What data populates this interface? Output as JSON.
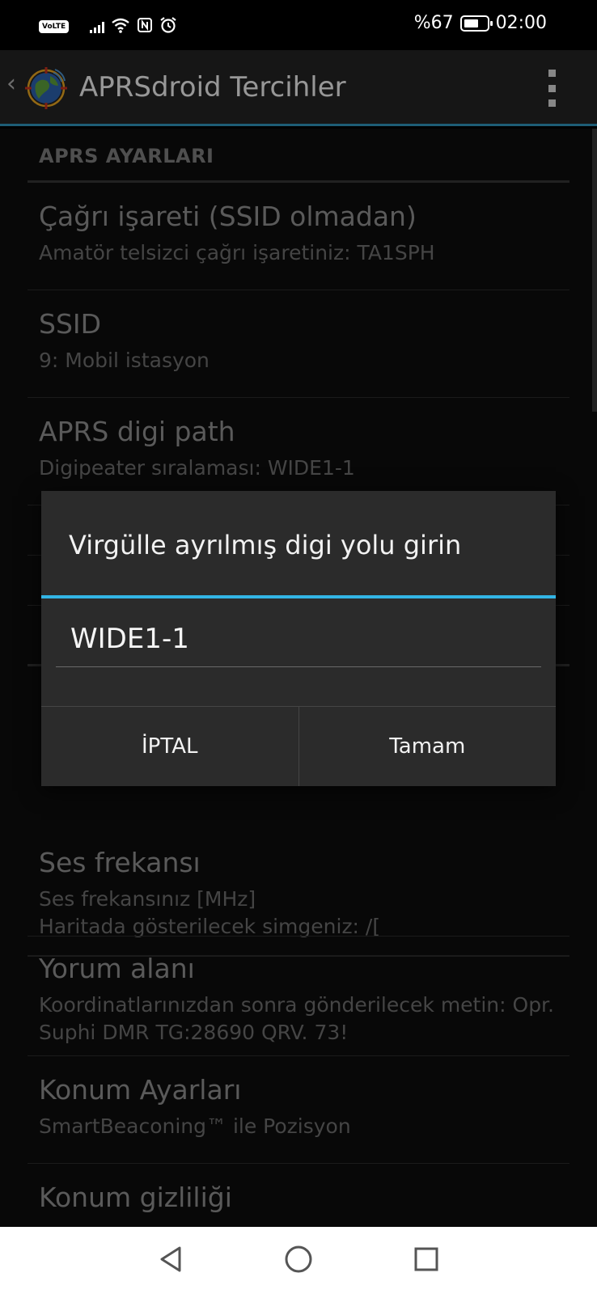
{
  "status_bar": {
    "volte": "VoLTE",
    "battery_text": "%67",
    "battery_level": 0.67,
    "time": "02:00",
    "icons": [
      "signal-icon",
      "wifi-icon",
      "nfc-icon",
      "alarm-icon"
    ]
  },
  "action_bar": {
    "title": "APRSdroid Tercihler",
    "back_icon": "chevron-left-icon",
    "menu_icon": "overflow-menu-icon"
  },
  "preferences": {
    "section_header": "APRS AYARLARI",
    "items": [
      {
        "title": "Çağrı işareti (SSID olmadan)",
        "summary": "Amatör telsizci çağrı işaretiniz: TA1SPH"
      },
      {
        "title": "SSID",
        "summary": "9: Mobil istasyon"
      },
      {
        "title": "APRS digi path",
        "summary": "Digipeater sıralaması: WIDE1-1"
      },
      {
        "title": "",
        "summary": "Haritada gösterilecek simgeniz: /["
      },
      {
        "title": "Ses frekansı",
        "summary": "Ses frekansınız [MHz]"
      },
      {
        "title": "Yorum alanı",
        "summary": "Koordinatlarınızdan sonra gönderilecek metin: Opr. Suphi DMR TG:28690 QRV. 73!"
      },
      {
        "title": "Konum Ayarları",
        "summary": "SmartBeaconing™ ile Pozisyon"
      },
      {
        "title": "Konum gizliliği",
        "summary": ""
      }
    ]
  },
  "dialog": {
    "title": "Virgülle ayrılmış digi yolu girin",
    "input_value": "WIDE1-1",
    "cancel_label": "İPTAL",
    "ok_label": "Tamam",
    "accent_color": "#33b5e5"
  },
  "nav_bar": {
    "back_icon": "triangle-back-icon",
    "home_icon": "circle-home-icon",
    "recents_icon": "square-recents-icon"
  }
}
